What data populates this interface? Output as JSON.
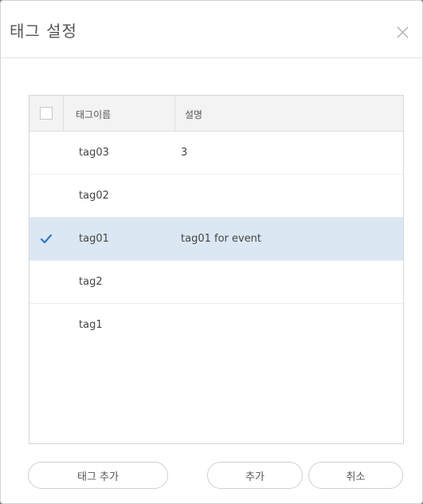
{
  "dialog": {
    "title": "태그 설정"
  },
  "table": {
    "columns": [
      "태그이름",
      "설명"
    ],
    "rows": [
      {
        "name": "tag03",
        "description": "3",
        "checked": false
      },
      {
        "name": "tag02",
        "description": "",
        "checked": false
      },
      {
        "name": "tag01",
        "description": "tag01 for event",
        "checked": true
      },
      {
        "name": "tag2",
        "description": "",
        "checked": false
      },
      {
        "name": "tag1",
        "description": "",
        "checked": false
      }
    ]
  },
  "buttons": {
    "add_tag": "태그 추가",
    "add": "추가",
    "cancel": "취소"
  },
  "colors": {
    "selected_row": "#dbe7f3",
    "check_accent": "#2f79c8"
  },
  "icons": {
    "close": "close-icon",
    "check": "checkmark-icon"
  }
}
